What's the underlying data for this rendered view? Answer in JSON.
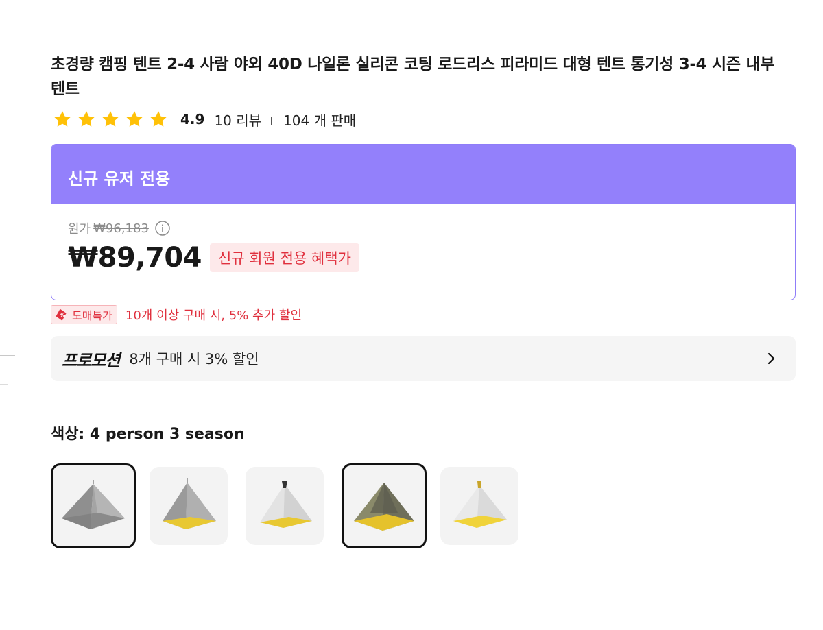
{
  "product": {
    "title": "초경량 캠핑 텐트 2-4 사람 야외 40D 나일론 실리콘 코팅 로드리스 피라미드 대형 텐트 통기성 3-4 시즌 내부 텐트",
    "rating": "4.9",
    "reviews": "10 리뷰",
    "sold": "104 개 판매",
    "star_count": 5
  },
  "deal": {
    "header": "신규 유저 전용",
    "original_label": "원가",
    "original_price": "₩96,183",
    "price": "₩89,704",
    "price_tag": "신규 회원 전용 혜택가"
  },
  "wholesale": {
    "badge": "도매특가",
    "text": "10개 이상 구매 시, 5% 추가 할인"
  },
  "promotion": {
    "logo": "프로모션",
    "text": "8개 구매 시 3% 할인"
  },
  "color": {
    "label": "색상: 4 person 3 season",
    "options": [
      {
        "name": "gray-tent",
        "selected": true
      },
      {
        "name": "gray-yellow-tent",
        "selected": false
      },
      {
        "name": "white-yellow-tent",
        "selected": false
      },
      {
        "name": "yellow-dark-tent",
        "selected": true
      },
      {
        "name": "white-yellow-tent-2",
        "selected": false
      }
    ]
  },
  "colors": {
    "accent": "#9380fb",
    "deal_red": "#e0303e",
    "star": "#ffc107"
  }
}
